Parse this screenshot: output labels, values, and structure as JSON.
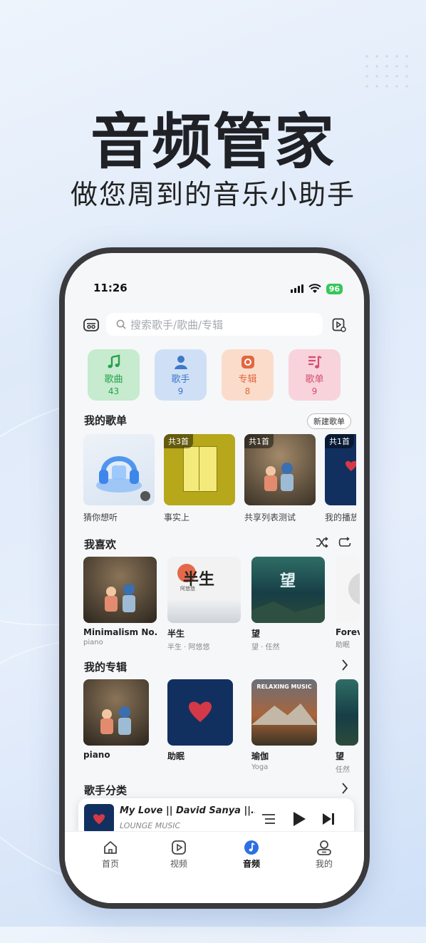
{
  "hero": {
    "title": "音频管家",
    "subtitle": "做您周到的音乐小助手"
  },
  "status": {
    "time": "11:26",
    "battery": "96"
  },
  "search": {
    "placeholder": "搜索歌手/歌曲/专辑"
  },
  "categories": [
    {
      "label": "歌曲",
      "count": "43",
      "icon": "music-note-icon",
      "bg": "#c6ebcf",
      "color": "#27a04c"
    },
    {
      "label": "歌手",
      "count": "9",
      "icon": "singer-icon",
      "bg": "#cfe0f6",
      "color": "#3f78c8"
    },
    {
      "label": "专辑",
      "count": "8",
      "icon": "album-icon",
      "bg": "#fbdccb",
      "color": "#e0683e"
    },
    {
      "label": "歌单",
      "count": "9",
      "icon": "playlist-icon",
      "bg": "#f8d3dc",
      "color": "#d84c6c"
    }
  ],
  "my_playlists": {
    "title": "我的歌单",
    "new_button": "新建歌单",
    "items": [
      {
        "name": "猜你想听",
        "badge": ""
      },
      {
        "name": "事实上",
        "badge": "共3首"
      },
      {
        "name": "共享列表测试",
        "badge": "共1首"
      },
      {
        "name": "我的播放",
        "badge": "共1首"
      }
    ]
  },
  "favorites": {
    "title": "我喜欢",
    "items": [
      {
        "title": "Minimalism No...",
        "sub": "piano"
      },
      {
        "title": "半生",
        "sub": "半生 · 阿悠悠",
        "art_text": "半生",
        "art_small": "阿悠悠"
      },
      {
        "title": "望",
        "sub": "望 · 任然",
        "art_text": "望"
      },
      {
        "title": "Forev",
        "sub": "助眠"
      }
    ]
  },
  "my_albums": {
    "title": "我的专辑",
    "items": [
      {
        "title": "piano",
        "sub": ""
      },
      {
        "title": "助眠",
        "sub": ""
      },
      {
        "title": "瑜伽",
        "sub": "Yoga",
        "art_text": "RELAXING MUSIC"
      },
      {
        "title": "望",
        "sub": "任然"
      }
    ]
  },
  "singers": {
    "title": "歌手分类"
  },
  "player": {
    "title": "My Love || David Sanya ||...",
    "subtitle": "LOUNGE MUSIC"
  },
  "tabs": [
    {
      "label": "首页",
      "icon": "home-icon",
      "active": false
    },
    {
      "label": "视频",
      "icon": "video-icon",
      "active": false
    },
    {
      "label": "音频",
      "icon": "audio-icon",
      "active": true
    },
    {
      "label": "我的",
      "icon": "profile-icon",
      "active": false
    }
  ]
}
